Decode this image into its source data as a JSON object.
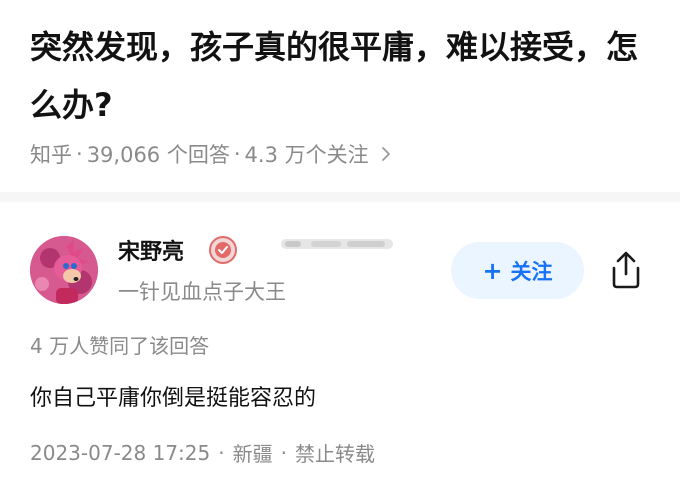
{
  "question": {
    "title": "突然发现，孩子真的很平庸，难以接受，怎么办?",
    "source": "知乎",
    "separator": "·",
    "answer_count": "39,066 个回答",
    "follower_count": "4.3 万个关注",
    "chevron_icon": "chevron-right-icon"
  },
  "author": {
    "avatar_icon": "avatar-image",
    "name": "宋野亮",
    "badge_icon": "medal-icon",
    "bio": "一针见血点子大王"
  },
  "actions": {
    "follow_plus": "+",
    "follow_label": "关注",
    "follow_color": "#1772f6",
    "follow_bg": "#ebf5ff",
    "share_icon": "share-icon"
  },
  "answer": {
    "vote_summary": "4 万人赞同了该回答",
    "content": "你自己平庸你倒是挺能容忍的",
    "date": "2023-07-28 17:25",
    "location": "新疆",
    "copyright": "禁止转载",
    "separator": "·"
  }
}
